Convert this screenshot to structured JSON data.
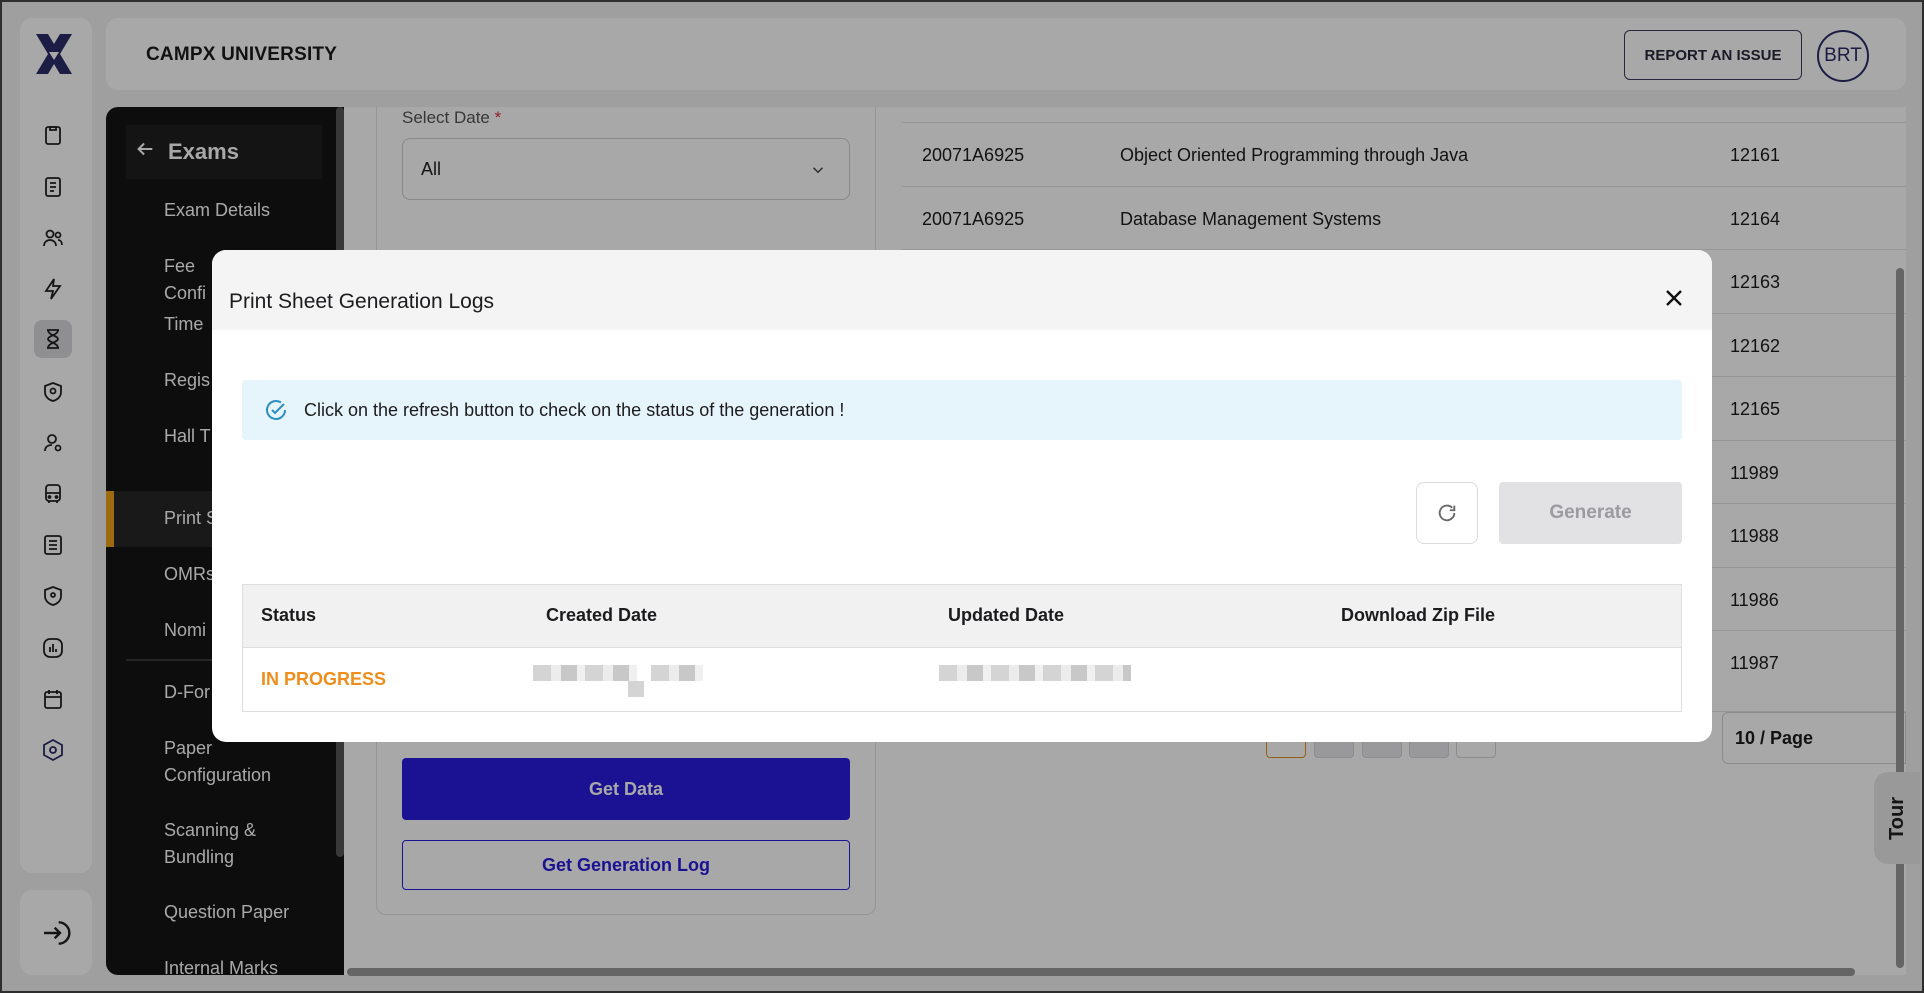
{
  "app": {
    "org_name": "CAMPX UNIVERSITY",
    "report_button": "REPORT AN ISSUE",
    "avatar_initials": "BRT",
    "brand_color": "#2a1ce0",
    "accent_color": "#f2a31c"
  },
  "rail": {
    "logo": "campx-x-logo",
    "icons": [
      "clipboard-icon",
      "notebook-icon",
      "users-icon",
      "lightning-icon",
      "hourglass-icon",
      "shield-settings-icon",
      "user-settings-icon",
      "bus-icon",
      "list-icon",
      "location-shield-icon",
      "chart-icon",
      "calendar-icon",
      "gear-hex-icon"
    ],
    "active_icon": "hourglass-icon",
    "logout_icon": "logout-icon"
  },
  "side_menu": {
    "back_label": "Exams",
    "items": [
      "Exam Details",
      "Fee Confi",
      "Time",
      "Regis",
      "Hall T",
      "Print S",
      "OMRs",
      "Nomi",
      "D-For",
      "Paper Configuration",
      "Scanning & Bundling",
      "Question Paper",
      "Internal Marks"
    ],
    "active_item": "Print S"
  },
  "filters": {
    "select_date_label": "Select Date",
    "required_mark": "*",
    "select_date_value": "All",
    "get_data_button": "Get Data",
    "get_generation_log_button": "Get Generation Log"
  },
  "background_table": {
    "rows": [
      {
        "roll": "20071A6925",
        "subject": "Object Oriented Programming through Java",
        "code": "12161"
      },
      {
        "roll": "20071A6925",
        "subject": "Database Management Systems",
        "code": "12164"
      },
      {
        "roll": "",
        "subject": "",
        "code": "12163"
      },
      {
        "roll": "",
        "subject": "",
        "code": "12162"
      },
      {
        "roll": "",
        "subject": "",
        "code": "12165"
      },
      {
        "roll": "",
        "subject": "",
        "code": "11989"
      },
      {
        "roll": "",
        "subject": "",
        "code": "11988"
      },
      {
        "roll": "",
        "subject": "",
        "code": "11986"
      },
      {
        "roll": "",
        "subject": "",
        "code": "11987"
      }
    ],
    "page_size": "10 / Page"
  },
  "tour_label": "Tour",
  "modal": {
    "title": "Print Sheet Generation Logs",
    "alert_text": "Click on the refresh button to check on the status of the generation !",
    "generate_button": "Generate",
    "columns": [
      "Status",
      "Created Date",
      "Updated Date",
      "Download Zip File"
    ],
    "rows": [
      {
        "status": "IN PROGRESS",
        "status_color": "#ee8e1c"
      }
    ]
  }
}
